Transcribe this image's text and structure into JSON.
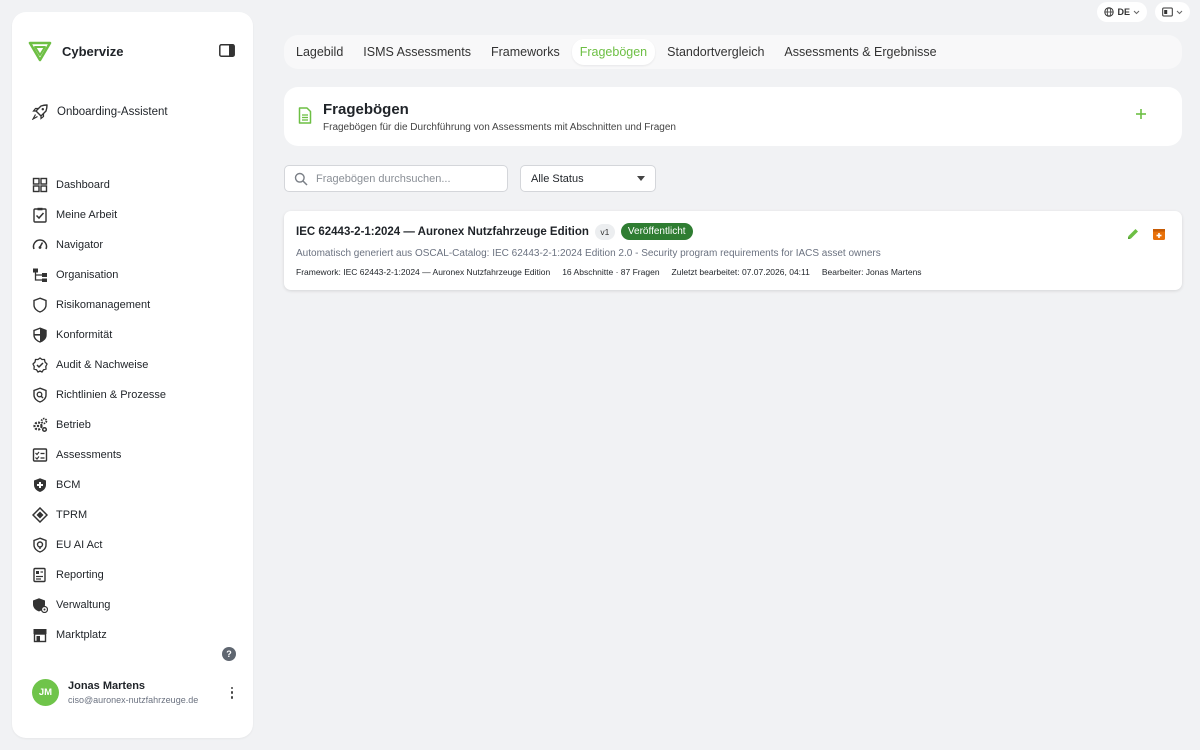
{
  "topbar": {
    "language": "DE"
  },
  "brand": {
    "name": "Cybervize"
  },
  "sidebar": {
    "onboarding": "Onboarding-Assistent",
    "items": [
      {
        "label": "Dashboard",
        "icon": "dashboard-icon"
      },
      {
        "label": "Meine Arbeit",
        "icon": "clipboard-check-icon"
      },
      {
        "label": "Navigator",
        "icon": "gauge-icon"
      },
      {
        "label": "Organisation",
        "icon": "org-chart-icon"
      },
      {
        "label": "Risikomanagement",
        "icon": "shield-outline-icon"
      },
      {
        "label": "Konformität",
        "icon": "shield-half-icon"
      },
      {
        "label": "Audit & Nachweise",
        "icon": "badge-check-icon"
      },
      {
        "label": "Richtlinien & Prozesse",
        "icon": "shield-search-icon"
      },
      {
        "label": "Betrieb",
        "icon": "gears-icon"
      },
      {
        "label": "Assessments",
        "icon": "checklist-icon"
      },
      {
        "label": "BCM",
        "icon": "shield-plus-icon"
      },
      {
        "label": "TPRM",
        "icon": "handshake-icon"
      },
      {
        "label": "EU AI Act",
        "icon": "shield-ai-icon"
      },
      {
        "label": "Reporting",
        "icon": "report-icon"
      },
      {
        "label": "Verwaltung",
        "icon": "shield-user-icon"
      },
      {
        "label": "Marktplatz",
        "icon": "store-icon"
      }
    ]
  },
  "user": {
    "initials": "JM",
    "name": "Jonas Martens",
    "email": "ciso@auronex-nutzfahrzeuge.de"
  },
  "tabs": [
    {
      "label": "Lagebild",
      "active": false
    },
    {
      "label": "ISMS Assessments",
      "active": false
    },
    {
      "label": "Frameworks",
      "active": false
    },
    {
      "label": "Fragebögen",
      "active": true
    },
    {
      "label": "Standortvergleich",
      "active": false
    },
    {
      "label": "Assessments & Ergebnisse",
      "active": false
    }
  ],
  "header": {
    "title": "Fragebögen",
    "subtitle": "Fragebögen für die Durchführung von Assessments mit Abschnitten und Fragen"
  },
  "filters": {
    "search_placeholder": "Fragebögen durchsuchen...",
    "status_value": "Alle Status"
  },
  "questionnaires": [
    {
      "title": "IEC 62443-2-1:2024 — Auronex Nutzfahrzeuge Edition",
      "version": "v1",
      "status": "Veröffentlicht",
      "description": "Automatisch generiert aus OSCAL-Catalog: IEC 62443-2-1:2024 Edition 2.0 - Security program requirements for IACS asset owners",
      "framework": "Framework: IEC 62443-2-1:2024 — Auronex Nutzfahrzeuge Edition",
      "counts": "16 Abschnitte · 87 Fragen",
      "last_edited": "Zuletzt bearbeitet: 07.07.2026, 04:11",
      "editor": "Bearbeiter: Jonas Martens"
    }
  ],
  "colors": {
    "accent": "#6dbf44",
    "status_published": "#2f7d32",
    "delete": "#e8710a"
  }
}
